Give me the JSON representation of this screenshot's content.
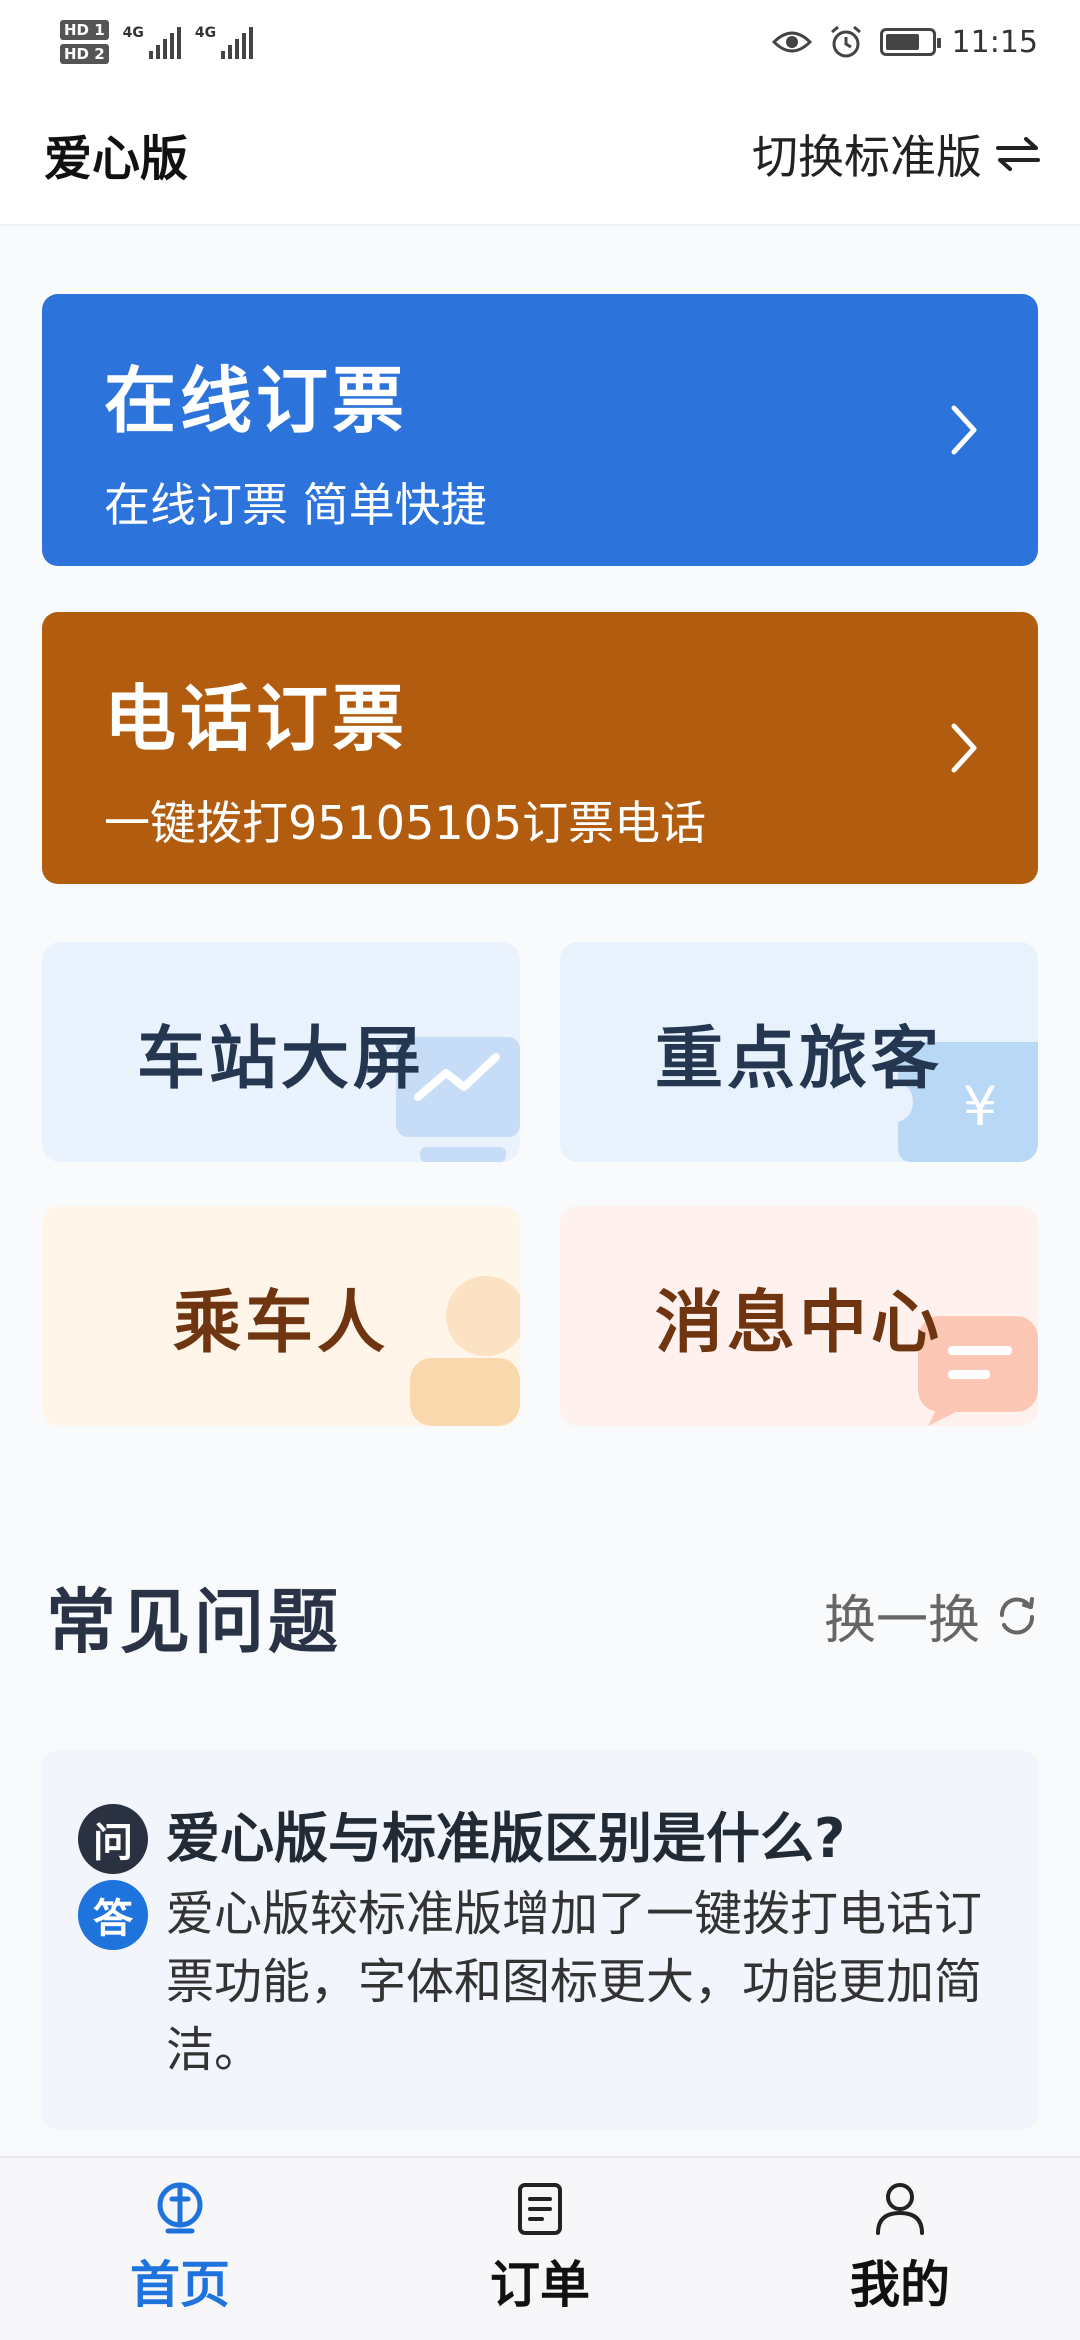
{
  "status_bar": {
    "hd1": "HD 1",
    "hd2": "HD 2",
    "net1": "4G",
    "net2": "4G",
    "time": "11:15",
    "battery_level": 0.75,
    "icons": [
      "eye-icon",
      "alarm-icon",
      "battery-icon"
    ]
  },
  "header": {
    "title": "爱心版",
    "switch_label": "切换标准版",
    "switch_icon": "swap-arrows-icon"
  },
  "cards": {
    "online": {
      "title": "在线订票",
      "subtitle": "在线订票 简单快捷",
      "color": "#2c73dc"
    },
    "phone": {
      "title": "电话订票",
      "subtitle": "一键拨打95105105订票电话",
      "color": "#b25c0f"
    }
  },
  "tiles": {
    "station": {
      "label": "车站大屏",
      "icon": "chart-screen-icon"
    },
    "key": {
      "label": "重点旅客",
      "icon": "yen-ticket-icon"
    },
    "passenger": {
      "label": "乘车人",
      "icon": "person-icon"
    },
    "message": {
      "label": "消息中心",
      "icon": "message-bubble-icon"
    }
  },
  "faq": {
    "title": "常见问题",
    "refresh_label": "换一换",
    "q_badge": "问",
    "a_badge": "答",
    "question": "爱心版与标准版区别是什么?",
    "answer": "爱心版较标准版增加了一键拨打电话订票功能，字体和图标更大，功能更加简洁。"
  },
  "nav": {
    "home": "首页",
    "orders": "订单",
    "mine": "我的",
    "active": "home"
  },
  "colors": {
    "primary": "#1f73dc",
    "brown": "#b25c0f"
  }
}
